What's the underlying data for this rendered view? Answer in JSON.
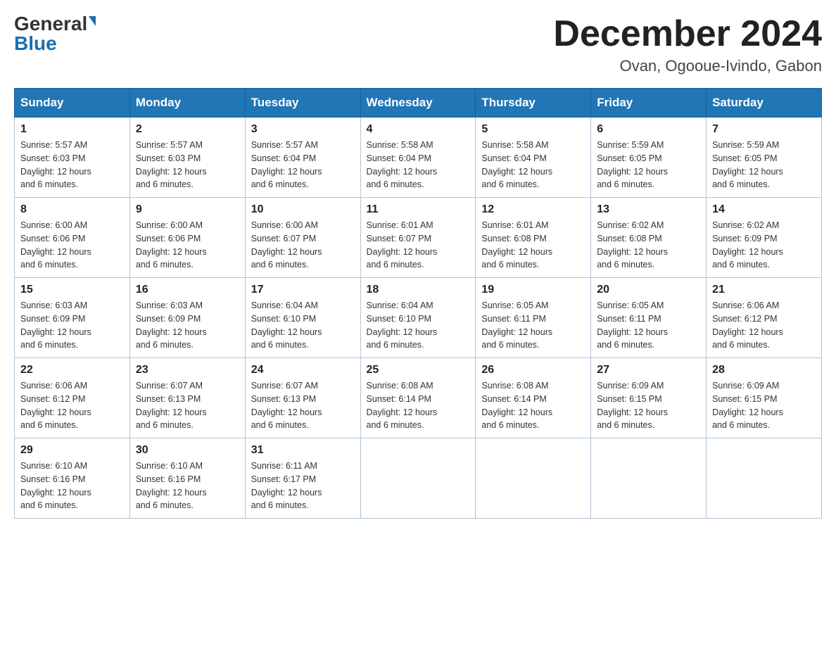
{
  "header": {
    "logo_general": "General",
    "logo_blue": "Blue",
    "title": "December 2024",
    "subtitle": "Ovan, Ogooue-Ivindo, Gabon"
  },
  "days_of_week": [
    "Sunday",
    "Monday",
    "Tuesday",
    "Wednesday",
    "Thursday",
    "Friday",
    "Saturday"
  ],
  "weeks": [
    [
      {
        "day": "1",
        "sunrise": "5:57 AM",
        "sunset": "6:03 PM",
        "daylight": "12 hours and 6 minutes."
      },
      {
        "day": "2",
        "sunrise": "5:57 AM",
        "sunset": "6:03 PM",
        "daylight": "12 hours and 6 minutes."
      },
      {
        "day": "3",
        "sunrise": "5:57 AM",
        "sunset": "6:04 PM",
        "daylight": "12 hours and 6 minutes."
      },
      {
        "day": "4",
        "sunrise": "5:58 AM",
        "sunset": "6:04 PM",
        "daylight": "12 hours and 6 minutes."
      },
      {
        "day": "5",
        "sunrise": "5:58 AM",
        "sunset": "6:04 PM",
        "daylight": "12 hours and 6 minutes."
      },
      {
        "day": "6",
        "sunrise": "5:59 AM",
        "sunset": "6:05 PM",
        "daylight": "12 hours and 6 minutes."
      },
      {
        "day": "7",
        "sunrise": "5:59 AM",
        "sunset": "6:05 PM",
        "daylight": "12 hours and 6 minutes."
      }
    ],
    [
      {
        "day": "8",
        "sunrise": "6:00 AM",
        "sunset": "6:06 PM",
        "daylight": "12 hours and 6 minutes."
      },
      {
        "day": "9",
        "sunrise": "6:00 AM",
        "sunset": "6:06 PM",
        "daylight": "12 hours and 6 minutes."
      },
      {
        "day": "10",
        "sunrise": "6:00 AM",
        "sunset": "6:07 PM",
        "daylight": "12 hours and 6 minutes."
      },
      {
        "day": "11",
        "sunrise": "6:01 AM",
        "sunset": "6:07 PM",
        "daylight": "12 hours and 6 minutes."
      },
      {
        "day": "12",
        "sunrise": "6:01 AM",
        "sunset": "6:08 PM",
        "daylight": "12 hours and 6 minutes."
      },
      {
        "day": "13",
        "sunrise": "6:02 AM",
        "sunset": "6:08 PM",
        "daylight": "12 hours and 6 minutes."
      },
      {
        "day": "14",
        "sunrise": "6:02 AM",
        "sunset": "6:09 PM",
        "daylight": "12 hours and 6 minutes."
      }
    ],
    [
      {
        "day": "15",
        "sunrise": "6:03 AM",
        "sunset": "6:09 PM",
        "daylight": "12 hours and 6 minutes."
      },
      {
        "day": "16",
        "sunrise": "6:03 AM",
        "sunset": "6:09 PM",
        "daylight": "12 hours and 6 minutes."
      },
      {
        "day": "17",
        "sunrise": "6:04 AM",
        "sunset": "6:10 PM",
        "daylight": "12 hours and 6 minutes."
      },
      {
        "day": "18",
        "sunrise": "6:04 AM",
        "sunset": "6:10 PM",
        "daylight": "12 hours and 6 minutes."
      },
      {
        "day": "19",
        "sunrise": "6:05 AM",
        "sunset": "6:11 PM",
        "daylight": "12 hours and 6 minutes."
      },
      {
        "day": "20",
        "sunrise": "6:05 AM",
        "sunset": "6:11 PM",
        "daylight": "12 hours and 6 minutes."
      },
      {
        "day": "21",
        "sunrise": "6:06 AM",
        "sunset": "6:12 PM",
        "daylight": "12 hours and 6 minutes."
      }
    ],
    [
      {
        "day": "22",
        "sunrise": "6:06 AM",
        "sunset": "6:12 PM",
        "daylight": "12 hours and 6 minutes."
      },
      {
        "day": "23",
        "sunrise": "6:07 AM",
        "sunset": "6:13 PM",
        "daylight": "12 hours and 6 minutes."
      },
      {
        "day": "24",
        "sunrise": "6:07 AM",
        "sunset": "6:13 PM",
        "daylight": "12 hours and 6 minutes."
      },
      {
        "day": "25",
        "sunrise": "6:08 AM",
        "sunset": "6:14 PM",
        "daylight": "12 hours and 6 minutes."
      },
      {
        "day": "26",
        "sunrise": "6:08 AM",
        "sunset": "6:14 PM",
        "daylight": "12 hours and 6 minutes."
      },
      {
        "day": "27",
        "sunrise": "6:09 AM",
        "sunset": "6:15 PM",
        "daylight": "12 hours and 6 minutes."
      },
      {
        "day": "28",
        "sunrise": "6:09 AM",
        "sunset": "6:15 PM",
        "daylight": "12 hours and 6 minutes."
      }
    ],
    [
      {
        "day": "29",
        "sunrise": "6:10 AM",
        "sunset": "6:16 PM",
        "daylight": "12 hours and 6 minutes."
      },
      {
        "day": "30",
        "sunrise": "6:10 AM",
        "sunset": "6:16 PM",
        "daylight": "12 hours and 6 minutes."
      },
      {
        "day": "31",
        "sunrise": "6:11 AM",
        "sunset": "6:17 PM",
        "daylight": "12 hours and 6 minutes."
      },
      null,
      null,
      null,
      null
    ]
  ]
}
